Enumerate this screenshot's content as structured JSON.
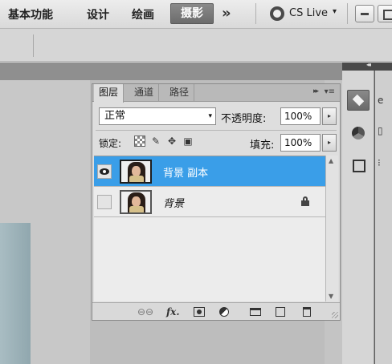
{
  "workspace_bar": {
    "items": [
      "基本功能",
      "设计",
      "绘画"
    ],
    "active": "摄影",
    "more": "»",
    "cs_live": "CS Live",
    "cs_live_arrow": "▾"
  },
  "layers_panel": {
    "tabs": [
      "图层",
      "通道",
      "路径"
    ],
    "collapse": "▸▸",
    "menu": "▾≡",
    "blend_mode": "正常",
    "blend_arrow": "▾",
    "opacity_label": "不透明度:",
    "opacity_value": "100%",
    "lock_label": "锁定:",
    "fill_label": "填充:",
    "fill_value": "100%",
    "stepper": "▸",
    "layers": [
      {
        "name": "背景 副本",
        "selected": true,
        "visible": true
      },
      {
        "name": "背景",
        "selected": false,
        "visible": false,
        "locked": true
      }
    ],
    "scroll_up": "▲",
    "scroll_down": "▼",
    "footer": {
      "link": "⊖⊖",
      "fx": "fx."
    }
  },
  "dock": {
    "collapse": "◂◂",
    "col2_icons": [
      "e",
      "▯",
      "⁝"
    ]
  },
  "colors": {
    "selected_row": "#3a9ee8",
    "dock_bg": "#5c5c5c",
    "active_workspace": "#7a7a7a"
  }
}
